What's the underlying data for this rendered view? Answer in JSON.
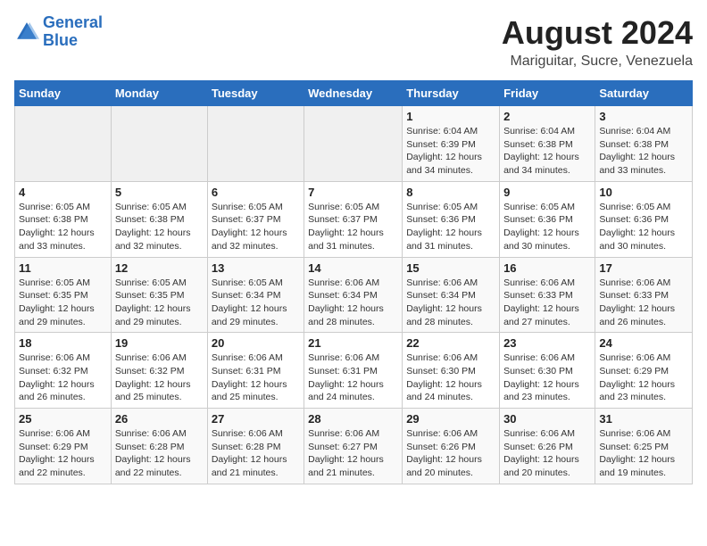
{
  "logo": {
    "line1": "General",
    "line2": "Blue"
  },
  "title": "August 2024",
  "subtitle": "Mariguitar, Sucre, Venezuela",
  "headers": [
    "Sunday",
    "Monday",
    "Tuesday",
    "Wednesday",
    "Thursday",
    "Friday",
    "Saturday"
  ],
  "weeks": [
    [
      {
        "day": "",
        "info": ""
      },
      {
        "day": "",
        "info": ""
      },
      {
        "day": "",
        "info": ""
      },
      {
        "day": "",
        "info": ""
      },
      {
        "day": "1",
        "info": "Sunrise: 6:04 AM\nSunset: 6:39 PM\nDaylight: 12 hours\nand 34 minutes."
      },
      {
        "day": "2",
        "info": "Sunrise: 6:04 AM\nSunset: 6:38 PM\nDaylight: 12 hours\nand 34 minutes."
      },
      {
        "day": "3",
        "info": "Sunrise: 6:04 AM\nSunset: 6:38 PM\nDaylight: 12 hours\nand 33 minutes."
      }
    ],
    [
      {
        "day": "4",
        "info": "Sunrise: 6:05 AM\nSunset: 6:38 PM\nDaylight: 12 hours\nand 33 minutes."
      },
      {
        "day": "5",
        "info": "Sunrise: 6:05 AM\nSunset: 6:38 PM\nDaylight: 12 hours\nand 32 minutes."
      },
      {
        "day": "6",
        "info": "Sunrise: 6:05 AM\nSunset: 6:37 PM\nDaylight: 12 hours\nand 32 minutes."
      },
      {
        "day": "7",
        "info": "Sunrise: 6:05 AM\nSunset: 6:37 PM\nDaylight: 12 hours\nand 31 minutes."
      },
      {
        "day": "8",
        "info": "Sunrise: 6:05 AM\nSunset: 6:36 PM\nDaylight: 12 hours\nand 31 minutes."
      },
      {
        "day": "9",
        "info": "Sunrise: 6:05 AM\nSunset: 6:36 PM\nDaylight: 12 hours\nand 30 minutes."
      },
      {
        "day": "10",
        "info": "Sunrise: 6:05 AM\nSunset: 6:36 PM\nDaylight: 12 hours\nand 30 minutes."
      }
    ],
    [
      {
        "day": "11",
        "info": "Sunrise: 6:05 AM\nSunset: 6:35 PM\nDaylight: 12 hours\nand 29 minutes."
      },
      {
        "day": "12",
        "info": "Sunrise: 6:05 AM\nSunset: 6:35 PM\nDaylight: 12 hours\nand 29 minutes."
      },
      {
        "day": "13",
        "info": "Sunrise: 6:05 AM\nSunset: 6:34 PM\nDaylight: 12 hours\nand 29 minutes."
      },
      {
        "day": "14",
        "info": "Sunrise: 6:06 AM\nSunset: 6:34 PM\nDaylight: 12 hours\nand 28 minutes."
      },
      {
        "day": "15",
        "info": "Sunrise: 6:06 AM\nSunset: 6:34 PM\nDaylight: 12 hours\nand 28 minutes."
      },
      {
        "day": "16",
        "info": "Sunrise: 6:06 AM\nSunset: 6:33 PM\nDaylight: 12 hours\nand 27 minutes."
      },
      {
        "day": "17",
        "info": "Sunrise: 6:06 AM\nSunset: 6:33 PM\nDaylight: 12 hours\nand 26 minutes."
      }
    ],
    [
      {
        "day": "18",
        "info": "Sunrise: 6:06 AM\nSunset: 6:32 PM\nDaylight: 12 hours\nand 26 minutes."
      },
      {
        "day": "19",
        "info": "Sunrise: 6:06 AM\nSunset: 6:32 PM\nDaylight: 12 hours\nand 25 minutes."
      },
      {
        "day": "20",
        "info": "Sunrise: 6:06 AM\nSunset: 6:31 PM\nDaylight: 12 hours\nand 25 minutes."
      },
      {
        "day": "21",
        "info": "Sunrise: 6:06 AM\nSunset: 6:31 PM\nDaylight: 12 hours\nand 24 minutes."
      },
      {
        "day": "22",
        "info": "Sunrise: 6:06 AM\nSunset: 6:30 PM\nDaylight: 12 hours\nand 24 minutes."
      },
      {
        "day": "23",
        "info": "Sunrise: 6:06 AM\nSunset: 6:30 PM\nDaylight: 12 hours\nand 23 minutes."
      },
      {
        "day": "24",
        "info": "Sunrise: 6:06 AM\nSunset: 6:29 PM\nDaylight: 12 hours\nand 23 minutes."
      }
    ],
    [
      {
        "day": "25",
        "info": "Sunrise: 6:06 AM\nSunset: 6:29 PM\nDaylight: 12 hours\nand 22 minutes."
      },
      {
        "day": "26",
        "info": "Sunrise: 6:06 AM\nSunset: 6:28 PM\nDaylight: 12 hours\nand 22 minutes."
      },
      {
        "day": "27",
        "info": "Sunrise: 6:06 AM\nSunset: 6:28 PM\nDaylight: 12 hours\nand 21 minutes."
      },
      {
        "day": "28",
        "info": "Sunrise: 6:06 AM\nSunset: 6:27 PM\nDaylight: 12 hours\nand 21 minutes."
      },
      {
        "day": "29",
        "info": "Sunrise: 6:06 AM\nSunset: 6:26 PM\nDaylight: 12 hours\nand 20 minutes."
      },
      {
        "day": "30",
        "info": "Sunrise: 6:06 AM\nSunset: 6:26 PM\nDaylight: 12 hours\nand 20 minutes."
      },
      {
        "day": "31",
        "info": "Sunrise: 6:06 AM\nSunset: 6:25 PM\nDaylight: 12 hours\nand 19 minutes."
      }
    ]
  ]
}
